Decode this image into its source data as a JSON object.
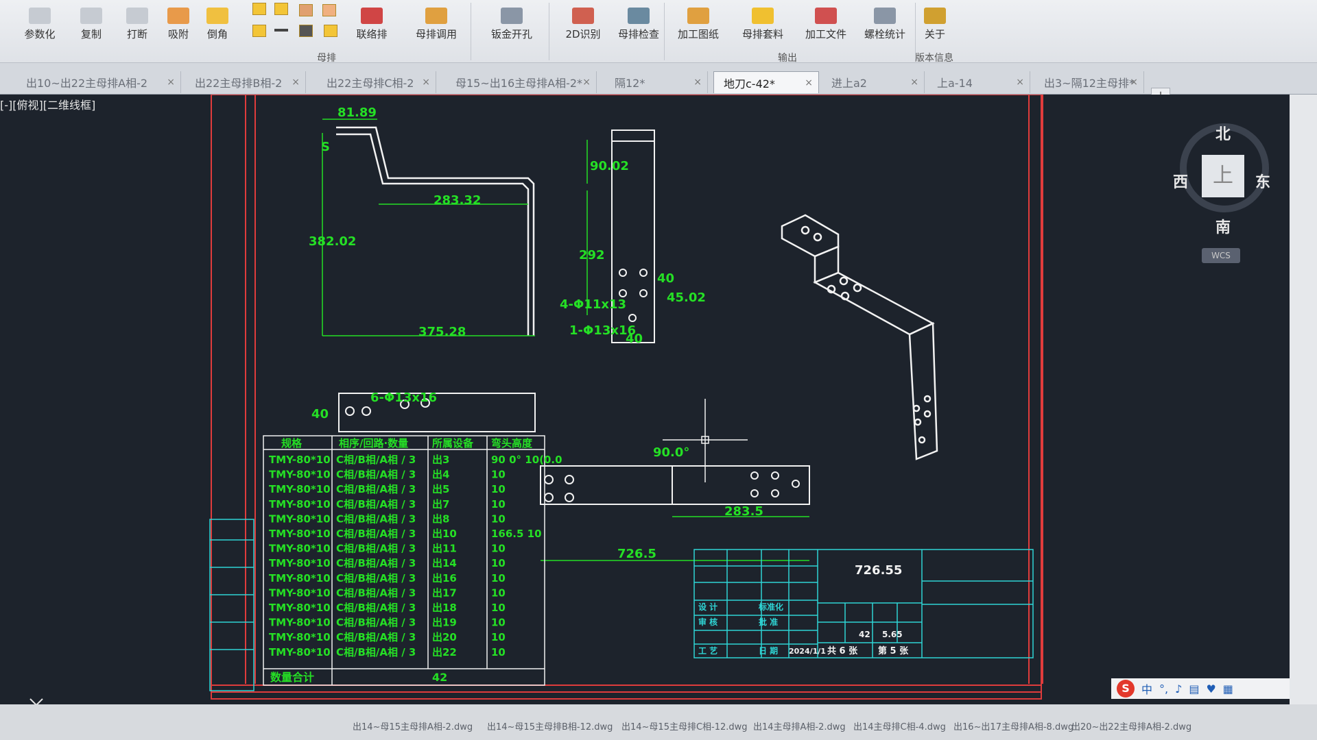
{
  "ribbon": {
    "buttons": [
      "参数化",
      "复制",
      "打断",
      "吸附",
      "倒角",
      "联络排",
      "母排调用",
      "钣金开孔",
      "2D识别",
      "母排检查",
      "加工图纸",
      "母排套料",
      "加工文件",
      "螺栓统计",
      "关于"
    ],
    "groups": [
      "母排",
      "输出",
      "版本信息"
    ]
  },
  "tabs": [
    "出10~出22主母排A相-2",
    "出22主母排B相-2",
    "出22主母排C相-2",
    "母15~出16主母排A相-2*",
    "隔12*",
    "地刀c-42*",
    "进上a2",
    "上a-14",
    "出3~隔12主母排*"
  ],
  "active_tab_index": 5,
  "viewport": {
    "label": "[-][俯视][二维线框]"
  },
  "viewcube": {
    "north": "北",
    "south": "南",
    "east": "东",
    "west": "西",
    "face": "上",
    "wcs": "WCS"
  },
  "dimensions": [
    "81.89",
    "S",
    "90.02",
    "283.32",
    "382.02",
    "292",
    "375.28",
    "4-Φ11x13",
    "45.02",
    "40",
    "1-Φ13x16",
    "40",
    "40",
    "6-Φ13x16",
    "90.0°",
    "283.5",
    "726.5",
    "726.55"
  ],
  "table": {
    "headers": [
      "规格",
      "相序/回路·数量",
      "所属设备",
      "弯头高度"
    ],
    "rows": [
      [
        "TMY-80*10",
        "C相/B相/A相 / 3",
        "出3",
        "90 0°  10(0.0"
      ],
      [
        "TMY-80*10",
        "C相/B相/A相 / 3",
        "出4",
        "10"
      ],
      [
        "TMY-80*10",
        "C相/B相/A相 / 3",
        "出5",
        "10"
      ],
      [
        "TMY-80*10",
        "C相/B相/A相 / 3",
        "出7",
        "10"
      ],
      [
        "TMY-80*10",
        "C相/B相/A相 / 3",
        "出8",
        "10"
      ],
      [
        "TMY-80*10",
        "C相/B相/A相 / 3",
        "出10",
        "166.5 10"
      ],
      [
        "TMY-80*10",
        "C相/B相/A相 / 3",
        "出11",
        "10"
      ],
      [
        "TMY-80*10",
        "C相/B相/A相 / 3",
        "出14",
        "10"
      ],
      [
        "TMY-80*10",
        "C相/B相/A相 / 3",
        "出16",
        "10"
      ],
      [
        "TMY-80*10",
        "C相/B相/A相 / 3",
        "出17",
        "10"
      ],
      [
        "TMY-80*10",
        "C相/B相/A相 / 3",
        "出18",
        "10"
      ],
      [
        "TMY-80*10",
        "C相/B相/A相 / 3",
        "出19",
        "10"
      ],
      [
        "TMY-80*10",
        "C相/B相/A相 / 3",
        "出20",
        "10"
      ],
      [
        "TMY-80*10",
        "C相/B相/A相 / 3",
        "出22",
        "10"
      ]
    ],
    "total_label": "数量合计",
    "total_value": "42"
  },
  "titleblock": {
    "value": "726.55",
    "qty": "42",
    "weight": "5.65",
    "date": "2024/1/1",
    "sheets": "共 6 张",
    "sheet_no": "第 5 张",
    "labels": [
      "设 计",
      "审 核",
      "工 艺",
      "标准化",
      "日 期",
      "批 准"
    ]
  },
  "files": [
    "出14~母15主母排A相-2.dwg",
    "出14~母15主母排B相-12.dwg",
    "出14~母15主母排C相-12.dwg",
    "出14主母排A相-2.dwg",
    "出14主母排C相-4.dwg",
    "出16~出17主母排A相-8.dwg",
    "出20~出22主母排A相-2.dwg"
  ],
  "ime": {
    "logo": "S",
    "mode": "中"
  },
  "colors": {
    "bg": "#1d232c",
    "green": "#25e025",
    "red": "#e03c3c",
    "cyan": "#2fd5d5",
    "white": "#f2f2f2"
  }
}
